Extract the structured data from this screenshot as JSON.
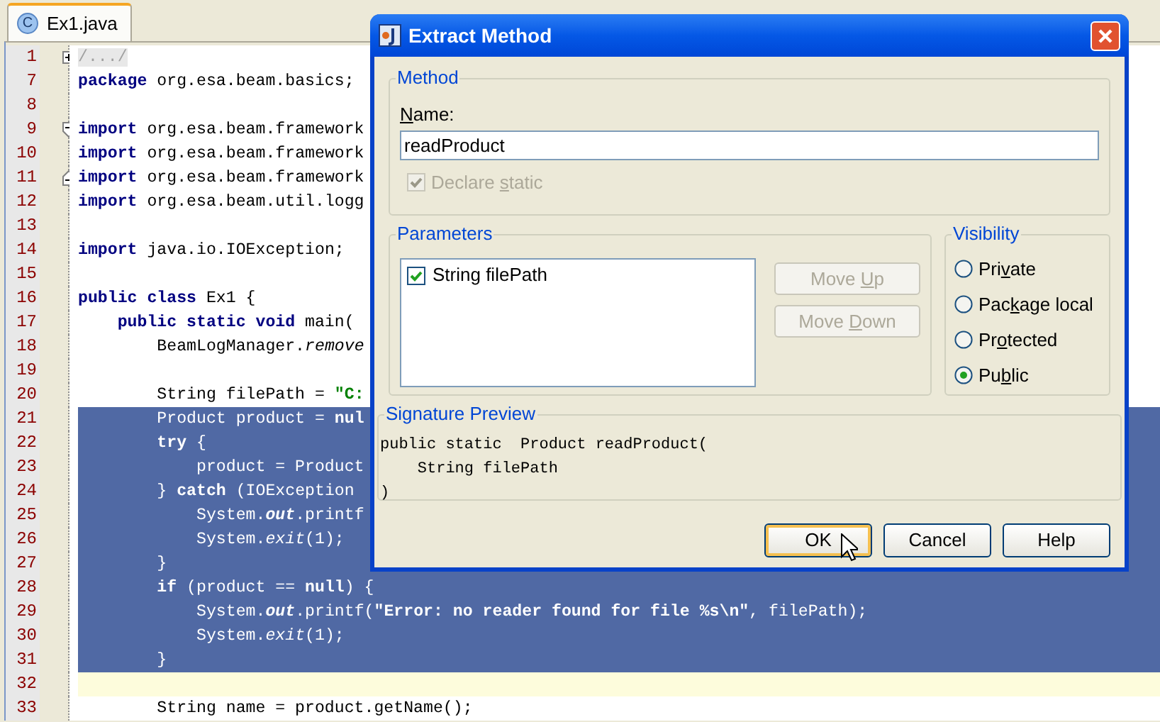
{
  "editor": {
    "tab": {
      "icon_letter": "C",
      "label": "Ex1.java",
      "selected": true
    },
    "lines": [
      {
        "number": "1",
        "fold": {
          "kind": "plus"
        },
        "selected": false,
        "current": false,
        "segments": [
          {
            "kind": "comment",
            "text": "/.../"
          }
        ]
      },
      {
        "number": "7",
        "selected": false,
        "current": false,
        "segments": [
          {
            "kind": "keyword",
            "text": "package"
          },
          {
            "kind": "text",
            "text": " org.esa.beam.basics;"
          }
        ]
      },
      {
        "number": "8",
        "selected": false,
        "current": false
      },
      {
        "number": "9",
        "fold": {
          "kind": "minus"
        },
        "selected": false,
        "current": false,
        "segments": [
          {
            "kind": "keyword",
            "text": "import"
          },
          {
            "kind": "text",
            "text": " org.esa.beam.framework"
          }
        ]
      },
      {
        "number": "10",
        "selected": false,
        "current": false,
        "segments": [
          {
            "kind": "keyword",
            "text": "import"
          },
          {
            "kind": "text",
            "text": " org.esa.beam.framework"
          }
        ]
      },
      {
        "number": "11",
        "fold": {
          "kind": "end"
        },
        "selected": false,
        "current": false,
        "segments": [
          {
            "kind": "keyword",
            "text": "import"
          },
          {
            "kind": "text",
            "text": " org.esa.beam.framework"
          }
        ]
      },
      {
        "number": "12",
        "selected": false,
        "current": false,
        "segments": [
          {
            "kind": "keyword",
            "text": "import"
          },
          {
            "kind": "text",
            "text": " org.esa.beam.util.logg"
          }
        ]
      },
      {
        "number": "13",
        "selected": false,
        "current": false
      },
      {
        "number": "14",
        "selected": false,
        "current": false,
        "segments": [
          {
            "kind": "keyword",
            "text": "import"
          },
          {
            "kind": "text",
            "text": " java.io.IOException;"
          }
        ]
      },
      {
        "number": "15",
        "selected": false,
        "current": false
      },
      {
        "number": "16",
        "selected": false,
        "current": false,
        "segments": [
          {
            "kind": "keyword",
            "text": "public class"
          },
          {
            "kind": "text",
            "text": " Ex1 {"
          }
        ]
      },
      {
        "number": "17",
        "selected": false,
        "current": false,
        "segments": [
          {
            "kind": "keyword",
            "text": "    public static void"
          },
          {
            "kind": "text",
            "text": " main("
          }
        ]
      },
      {
        "number": "18",
        "selected": false,
        "current": false,
        "segments": [
          {
            "kind": "text",
            "text": "        BeamLogManager."
          },
          {
            "kind": "italic",
            "text": "remove"
          }
        ]
      },
      {
        "number": "19",
        "selected": false,
        "current": false
      },
      {
        "number": "20",
        "selected": false,
        "current": false,
        "segments": [
          {
            "kind": "text",
            "text": "        String filePath = "
          },
          {
            "kind": "string",
            "text": "\"C:"
          }
        ]
      },
      {
        "number": "21",
        "selected": true,
        "current": false,
        "segments": [
          {
            "kind": "text",
            "text": "        Product product = "
          },
          {
            "kind": "keyword",
            "text": "nul"
          }
        ]
      },
      {
        "number": "22",
        "selected": true,
        "current": false,
        "segments": [
          {
            "kind": "keyword",
            "text": "        try"
          },
          {
            "kind": "text",
            "text": " {"
          }
        ]
      },
      {
        "number": "23",
        "selected": true,
        "current": false,
        "segments": [
          {
            "kind": "text",
            "text": "            product = Product"
          }
        ]
      },
      {
        "number": "24",
        "selected": true,
        "current": false,
        "segments": [
          {
            "kind": "text",
            "text": "        } "
          },
          {
            "kind": "keyword",
            "text": "catch"
          },
          {
            "kind": "text",
            "text": " (IOException"
          }
        ]
      },
      {
        "number": "25",
        "selected": true,
        "current": false,
        "segments": [
          {
            "kind": "text",
            "text": "            System."
          },
          {
            "kind": "field",
            "text": "out"
          },
          {
            "kind": "text",
            "text": ".printf"
          }
        ]
      },
      {
        "number": "26",
        "selected": true,
        "current": false,
        "segments": [
          {
            "kind": "text",
            "text": "            System."
          },
          {
            "kind": "italic",
            "text": "exit"
          },
          {
            "kind": "text",
            "text": "(1);"
          }
        ]
      },
      {
        "number": "27",
        "selected": true,
        "current": false,
        "segments": [
          {
            "kind": "text",
            "text": "        }"
          }
        ]
      },
      {
        "number": "28",
        "selected": true,
        "current": false,
        "segments": [
          {
            "kind": "keyword",
            "text": "        if"
          },
          {
            "kind": "text",
            "text": " (product == "
          },
          {
            "kind": "keyword",
            "text": "null"
          },
          {
            "kind": "text",
            "text": ") {"
          }
        ]
      },
      {
        "number": "29",
        "selected": true,
        "current": false,
        "segments": [
          {
            "kind": "text",
            "text": "            System."
          },
          {
            "kind": "field",
            "text": "out"
          },
          {
            "kind": "text",
            "text": ".printf("
          },
          {
            "kind": "string",
            "text": "\"Error: no reader found for file %s\\n\""
          },
          {
            "kind": "text",
            "text": ", filePath);"
          }
        ]
      },
      {
        "number": "30",
        "selected": true,
        "current": false,
        "segments": [
          {
            "kind": "text",
            "text": "            System."
          },
          {
            "kind": "italic",
            "text": "exit"
          },
          {
            "kind": "text",
            "text": "(1);"
          }
        ]
      },
      {
        "number": "31",
        "selected": true,
        "current": false,
        "segments": [
          {
            "kind": "text",
            "text": "        }"
          }
        ]
      },
      {
        "number": "32",
        "selected": false,
        "current": true
      },
      {
        "number": "33",
        "selected": false,
        "current": false,
        "segments": [
          {
            "kind": "text",
            "text": "        String name = product.getName();"
          }
        ]
      }
    ]
  },
  "dialog": {
    "title": "Extract Method",
    "method": {
      "title": "Method",
      "name_label": [
        {
          "kind": "mnemonic",
          "text": "N"
        },
        {
          "kind": "plain",
          "text": "ame:"
        }
      ],
      "name_value": "readProduct",
      "declare_static": {
        "label": [
          {
            "kind": "plain",
            "text": "Declare "
          },
          {
            "kind": "mnemonic",
            "text": "s"
          },
          {
            "kind": "plain",
            "text": "tatic"
          }
        ],
        "checked": true,
        "disabled": true
      }
    },
    "parameters": {
      "title": "Parameters",
      "items": [
        {
          "label": "String filePath",
          "checked": true
        }
      ],
      "buttons": [
        {
          "label": [
            {
              "kind": "plain",
              "text": "Move "
            },
            {
              "kind": "mnemonic",
              "text": "U"
            },
            {
              "kind": "plain",
              "text": "p"
            }
          ],
          "disabled": true
        },
        {
          "label": [
            {
              "kind": "plain",
              "text": "Move "
            },
            {
              "kind": "mnemonic",
              "text": "D"
            },
            {
              "kind": "plain",
              "text": "own"
            }
          ],
          "disabled": true
        }
      ]
    },
    "visibility": {
      "title": "Visibility",
      "options": [
        {
          "label": [
            {
              "kind": "plain",
              "text": "Pri"
            },
            {
              "kind": "mnemonic",
              "text": "v"
            },
            {
              "kind": "plain",
              "text": "ate"
            }
          ],
          "selected": false
        },
        {
          "label": [
            {
              "kind": "plain",
              "text": "Pac"
            },
            {
              "kind": "mnemonic",
              "text": "k"
            },
            {
              "kind": "plain",
              "text": "age local"
            }
          ],
          "selected": false
        },
        {
          "label": [
            {
              "kind": "plain",
              "text": "Pr"
            },
            {
              "kind": "mnemonic",
              "text": "o"
            },
            {
              "kind": "plain",
              "text": "tected"
            }
          ],
          "selected": false
        },
        {
          "label": [
            {
              "kind": "plain",
              "text": "Pu"
            },
            {
              "kind": "mnemonic",
              "text": "b"
            },
            {
              "kind": "plain",
              "text": "lic"
            }
          ],
          "selected": true
        }
      ]
    },
    "signature_preview": {
      "title": "Signature Preview",
      "lines": [
        "public static  Product readProduct(",
        "    String filePath",
        ")"
      ]
    },
    "buttons": [
      {
        "label": "OK",
        "default": true
      },
      {
        "label": "Cancel",
        "default": false
      },
      {
        "label": "Help",
        "default": false
      }
    ]
  }
}
